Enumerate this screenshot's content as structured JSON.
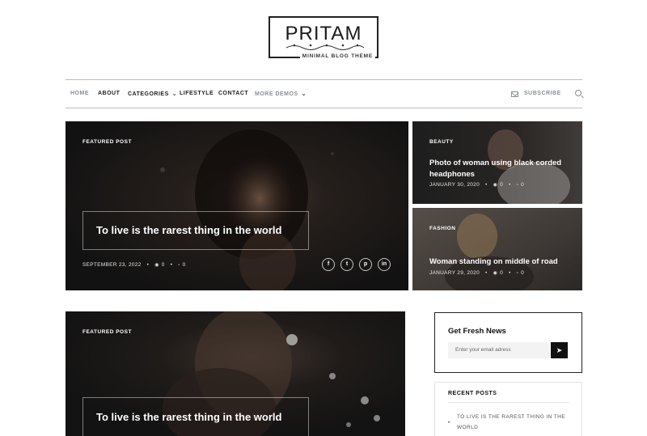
{
  "logo": {
    "title": "PRITAM",
    "tagline": "MINIMAL BLOG THEME"
  },
  "nav": {
    "items": [
      {
        "label": "HOME",
        "active": true
      },
      {
        "label": "ABOUT"
      },
      {
        "label": "CATEGORIES",
        "caret": true
      },
      {
        "label": "LIFESTYLE"
      },
      {
        "label": "CONTACT"
      },
      {
        "label": "MORE DEMOS",
        "caret": true,
        "muted": true
      }
    ],
    "subscribe": "SUBSCRIBE",
    "icons": {
      "subscribe": "mail-icon",
      "search": "search-icon"
    }
  },
  "hero": {
    "tag": "FEATURED POST",
    "title": "To live is the rarest thing in the world",
    "date": "SEPTEMBER 23, 2022",
    "views": "0",
    "comments": "0",
    "social": [
      "f",
      "t",
      "p",
      "in"
    ],
    "social_icons": [
      "facebook-icon",
      "twitter-icon",
      "pinterest-icon",
      "linkedin-icon"
    ]
  },
  "side_posts": [
    {
      "tag": "BEAUTY",
      "title": "Photo of woman using black corded headphones",
      "date": "JANUARY 30, 2020",
      "views": "0",
      "comments": "0"
    },
    {
      "tag": "FASHION",
      "title": "Woman standing on middle of road",
      "date": "JANUARY 29, 2020",
      "views": "0",
      "comments": "0"
    }
  ],
  "featured2": {
    "tag": "FEATURED POST",
    "title": "To live is the rarest thing in the world"
  },
  "newsletter": {
    "title": "Get Fresh News",
    "placeholder": "Enter your email adress",
    "send_icon": "send-icon"
  },
  "recent": {
    "title": "RECENT POSTS",
    "items": [
      "TO LIVE IS THE RAREST THING IN THE WORLD"
    ]
  },
  "colors": {
    "text": "#222222",
    "muted": "#8a8f97",
    "border": "#bdbdbd",
    "dark": "#111111"
  }
}
